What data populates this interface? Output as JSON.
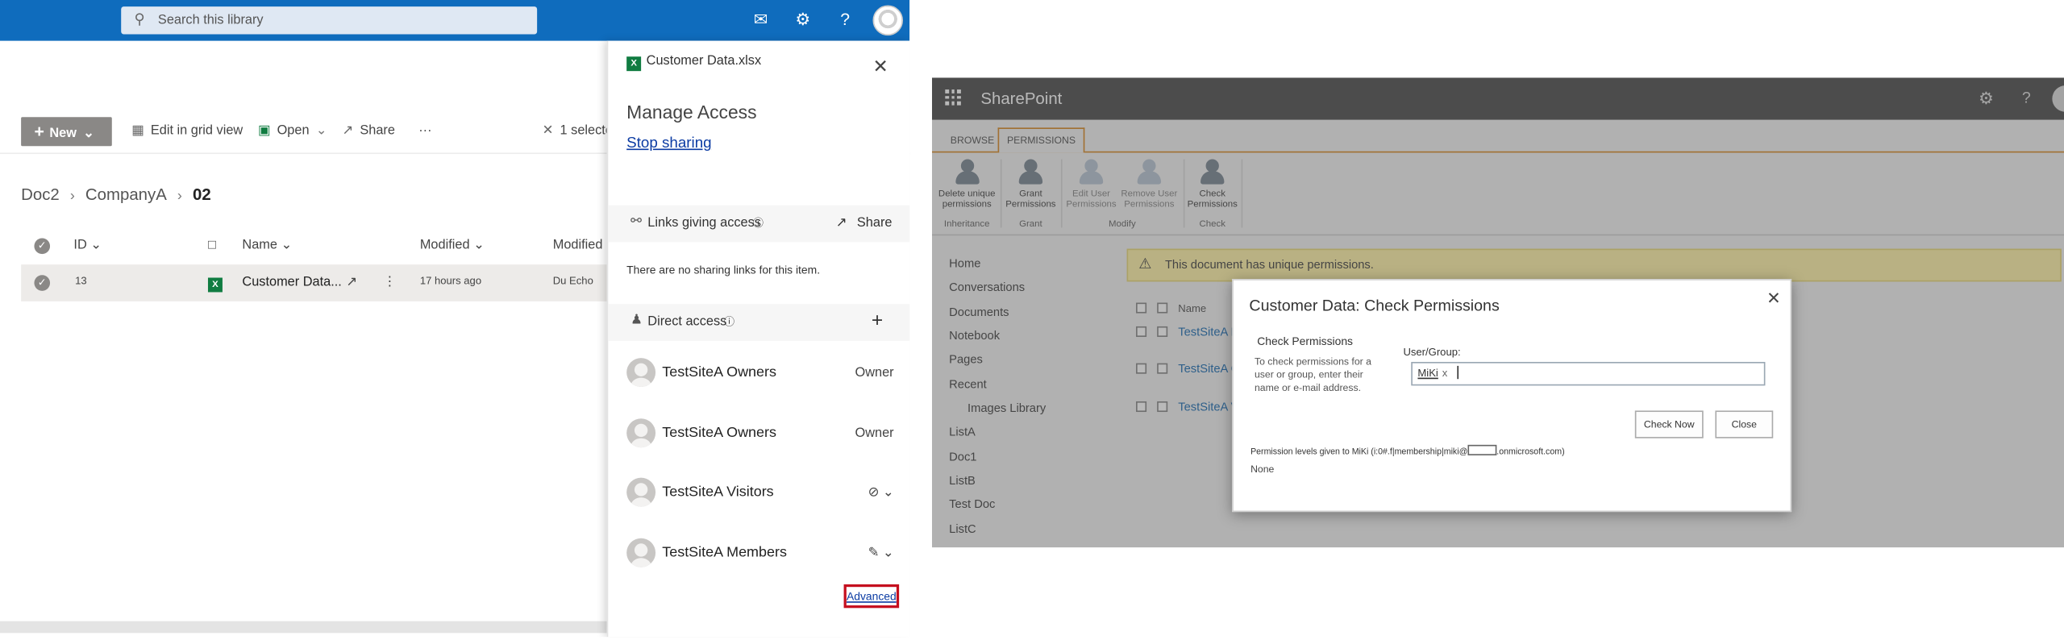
{
  "left": {
    "suite": {
      "search_placeholder": "Search this library"
    },
    "commands": {
      "new": "New",
      "edit_grid": "Edit in grid view",
      "open": "Open",
      "share": "Share",
      "more": "···",
      "selected": "1 selecte"
    },
    "breadcrumb": [
      "Doc2",
      "CompanyA",
      "02"
    ],
    "list": {
      "headers": {
        "id": "ID",
        "name": "Name",
        "modified": "Modified",
        "modified_by": "Modified"
      },
      "row": {
        "id": "13",
        "name": "Customer Data...",
        "modified": "17 hours ago",
        "modified_by": "Du Echo"
      }
    },
    "panel": {
      "file": "Customer Data.xlsx",
      "title": "Manage Access",
      "stop_sharing": "Stop sharing",
      "links_label": "Links giving access",
      "share_label": "Share",
      "no_links": "There are no sharing links for this item.",
      "direct_label": "Direct access",
      "add_label": "+",
      "people": [
        {
          "name": "TestSiteA Owners",
          "role": "Owner"
        },
        {
          "name": "TestSiteA Owners",
          "role": "Owner"
        },
        {
          "name": "TestSiteA Visitors",
          "role": ""
        },
        {
          "name": "TestSiteA Members",
          "role": ""
        }
      ],
      "advanced": "Advanced"
    }
  },
  "right": {
    "brand": "SharePoint",
    "tabs": [
      "BROWSE",
      "PERMISSIONS"
    ],
    "ribbon": [
      {
        "l1": "Delete unique",
        "l2": "permissions"
      },
      {
        "l1": "Grant",
        "l2": "Permissions"
      },
      {
        "l1": "Edit User",
        "l2": "Permissions"
      },
      {
        "l1": "Remove User",
        "l2": "Permissions"
      },
      {
        "l1": "Check",
        "l2": "Permissions"
      }
    ],
    "groups": [
      "Inheritance",
      "Grant",
      "Modify",
      "Check"
    ],
    "nav": [
      "Home",
      "Conversations",
      "Documents",
      "Notebook",
      "Pages",
      "Recent",
      "Images Library",
      "ListA",
      "Doc1",
      "ListB",
      "Test Doc",
      "ListC"
    ],
    "warning": "This document has unique permissions.",
    "list_header": "Name",
    "list_items": [
      "TestSiteA M",
      "TestSiteA C",
      "TestSiteA V"
    ],
    "dialog": {
      "title": "Customer Data: Check Permissions",
      "section": "Check Permissions",
      "desc": "To check permissions for a user or group, enter their name or e-mail address.",
      "user_label": "User/Group:",
      "token": "MiKi",
      "token_remove": "x",
      "check_now": "Check Now",
      "close": "Close",
      "perm_prefix": "Permission levels given to MiKi (i:0#.f|membership|miki@",
      "perm_suffix": ".onmicrosoft.com)",
      "result": "None"
    }
  }
}
